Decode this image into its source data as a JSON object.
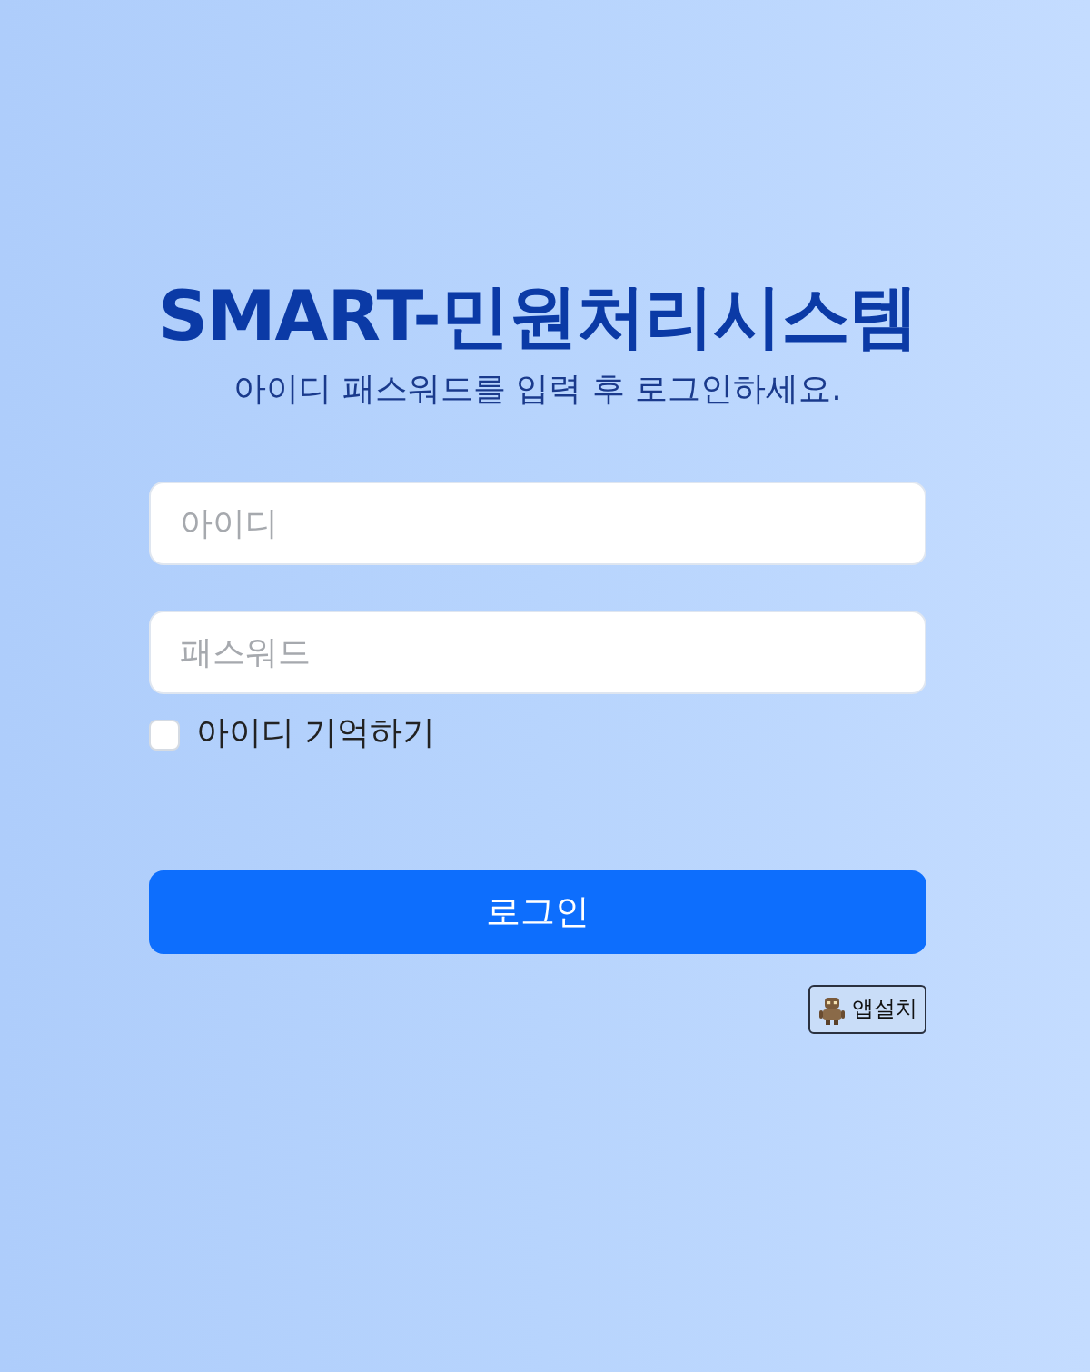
{
  "title": "SMART-민원처리시스템",
  "subtitle": "아이디 패스워드를 입력 후 로그인하세요.",
  "fields": [
    {
      "placeholder": "아이디"
    },
    {
      "placeholder": "패스워드"
    }
  ],
  "remember": {
    "label": "아이디 기억하기",
    "checked": false
  },
  "login_button": {
    "label": "로그인"
  },
  "app_install_button": {
    "label": "앱설치"
  }
}
